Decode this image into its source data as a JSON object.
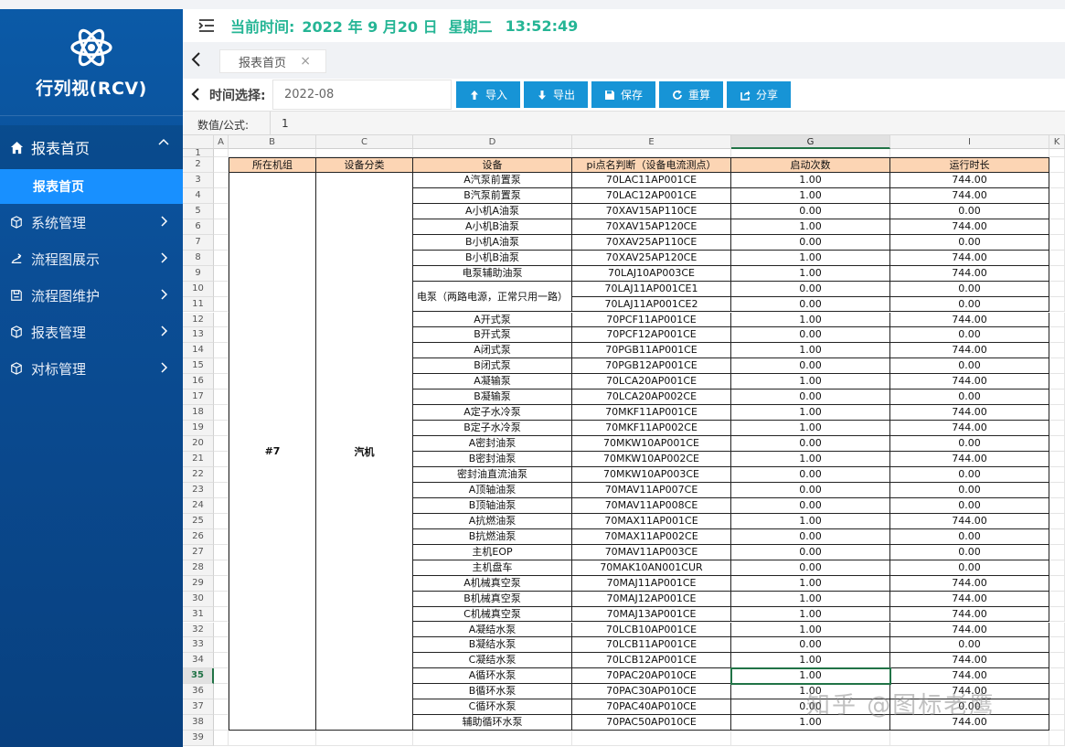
{
  "sidebar": {
    "title": "行列视(RCV)",
    "menu": [
      {
        "label": "报表首页",
        "icon": "home-icon",
        "open": true
      },
      {
        "label": "系统管理",
        "icon": "cube-icon"
      },
      {
        "label": "流程图展示",
        "icon": "flow-icon"
      },
      {
        "label": "流程图维护",
        "icon": "floppy-icon"
      },
      {
        "label": "报表管理",
        "icon": "cube-icon"
      },
      {
        "label": "对标管理",
        "icon": "cube-icon"
      }
    ],
    "submenu": {
      "label": "报表首页"
    }
  },
  "topbar": {
    "time_label": "当前时间:",
    "date": "2022 年 9 月20 日",
    "weekday": "星期二",
    "clock": "13:52:49"
  },
  "tabs": [
    {
      "label": "报表首页"
    }
  ],
  "toolbar": {
    "time_label": "时间选择:",
    "time_value": "2022-08",
    "buttons": [
      {
        "label": "导入",
        "icon": "arrow-up-icon"
      },
      {
        "label": "导出",
        "icon": "arrow-down-icon"
      },
      {
        "label": "保存",
        "icon": "save-icon"
      },
      {
        "label": "重算",
        "icon": "refresh-icon"
      },
      {
        "label": "分享",
        "icon": "share-icon"
      }
    ]
  },
  "formula": {
    "label": "数值/公式:",
    "value": "1"
  },
  "sheet": {
    "columns": [
      "A",
      "B",
      "C",
      "D",
      "E",
      "G",
      "I",
      "K"
    ],
    "selected_column": "G",
    "selected_row": 35,
    "row_numbers": [
      1,
      2,
      3,
      4,
      5,
      6,
      7,
      8,
      9,
      10,
      11,
      12,
      13,
      14,
      15,
      16,
      17,
      18,
      19,
      20,
      21,
      22,
      23,
      24,
      25,
      26,
      27,
      28,
      29,
      30,
      31,
      32,
      33,
      34,
      35,
      36,
      37,
      38,
      39
    ],
    "headers": [
      "所在机组",
      "设备分类",
      "设备",
      "pi点名判断（设备电流测点）",
      "启动次数",
      "运行时长"
    ],
    "group_unit": "#7",
    "group_category": "汽机",
    "merged_device": "电泵（两路电源，正常只用一路）",
    "rows": [
      {
        "device": "A汽泵前置泵",
        "pi": "70LAC11AP001CE",
        "starts": "1.00",
        "hours": "744.00"
      },
      {
        "device": "B汽泵前置泵",
        "pi": "70LAC12AP001CE",
        "starts": "1.00",
        "hours": "744.00"
      },
      {
        "device": "A小机A油泵",
        "pi": "70XAV15AP110CE",
        "starts": "0.00",
        "hours": "0.00"
      },
      {
        "device": "A小机B油泵",
        "pi": "70XAV15AP120CE",
        "starts": "1.00",
        "hours": "744.00"
      },
      {
        "device": "B小机A油泵",
        "pi": "70XAV25AP110CE",
        "starts": "0.00",
        "hours": "0.00"
      },
      {
        "device": "B小机B油泵",
        "pi": "70XAV25AP120CE",
        "starts": "1.00",
        "hours": "744.00"
      },
      {
        "device": "电泵辅助油泵",
        "pi": "70LAJ10AP003CE",
        "starts": "1.00",
        "hours": "744.00"
      },
      {
        "device": "",
        "pi": "70LAJ11AP001CE1",
        "starts": "0.00",
        "hours": "0.00"
      },
      {
        "device": "",
        "pi": "70LAJ11AP001CE2",
        "starts": "0.00",
        "hours": "0.00"
      },
      {
        "device": "A开式泵",
        "pi": "70PCF11AP001CE",
        "starts": "1.00",
        "hours": "744.00"
      },
      {
        "device": "B开式泵",
        "pi": "70PCF12AP001CE",
        "starts": "0.00",
        "hours": "0.00"
      },
      {
        "device": "A闭式泵",
        "pi": "70PGB11AP001CE",
        "starts": "1.00",
        "hours": "744.00"
      },
      {
        "device": "B闭式泵",
        "pi": "70PGB12AP001CE",
        "starts": "0.00",
        "hours": "0.00"
      },
      {
        "device": "A凝输泵",
        "pi": "70LCA20AP001CE",
        "starts": "1.00",
        "hours": "744.00"
      },
      {
        "device": "B凝输泵",
        "pi": "70LCA20AP002CE",
        "starts": "0.00",
        "hours": "0.00"
      },
      {
        "device": "A定子水冷泵",
        "pi": "70MKF11AP001CE",
        "starts": "1.00",
        "hours": "744.00"
      },
      {
        "device": "B定子水冷泵",
        "pi": "70MKF11AP002CE",
        "starts": "1.00",
        "hours": "744.00"
      },
      {
        "device": "A密封油泵",
        "pi": "70MKW10AP001CE",
        "starts": "0.00",
        "hours": "0.00"
      },
      {
        "device": "B密封油泵",
        "pi": "70MKW10AP002CE",
        "starts": "1.00",
        "hours": "744.00"
      },
      {
        "device": "密封油直流油泵",
        "pi": "70MKW10AP003CE",
        "starts": "0.00",
        "hours": "0.00"
      },
      {
        "device": "A顶轴油泵",
        "pi": "70MAV11AP007CE",
        "starts": "0.00",
        "hours": "0.00"
      },
      {
        "device": "B顶轴油泵",
        "pi": "70MAV11AP008CE",
        "starts": "0.00",
        "hours": "0.00"
      },
      {
        "device": "A抗燃油泵",
        "pi": "70MAX11AP001CE",
        "starts": "1.00",
        "hours": "744.00"
      },
      {
        "device": "B抗燃油泵",
        "pi": "70MAX11AP002CE",
        "starts": "0.00",
        "hours": "0.00"
      },
      {
        "device": "主机EOP",
        "pi": "70MAV11AP003CE",
        "starts": "0.00",
        "hours": "0.00"
      },
      {
        "device": "主机盘车",
        "pi": "70MAK10AN001CUR",
        "starts": "0.00",
        "hours": "0.00"
      },
      {
        "device": "A机械真空泵",
        "pi": "70MAJ11AP001CE",
        "starts": "1.00",
        "hours": "744.00"
      },
      {
        "device": "B机械真空泵",
        "pi": "70MAJ12AP001CE",
        "starts": "1.00",
        "hours": "744.00"
      },
      {
        "device": "C机械真空泵",
        "pi": "70MAJ13AP001CE",
        "starts": "1.00",
        "hours": "744.00"
      },
      {
        "device": "A凝结水泵",
        "pi": "70LCB10AP001CE",
        "starts": "1.00",
        "hours": "744.00"
      },
      {
        "device": "B凝结水泵",
        "pi": "70LCB11AP001CE",
        "starts": "0.00",
        "hours": "0.00"
      },
      {
        "device": "C凝结水泵",
        "pi": "70LCB12AP001CE",
        "starts": "1.00",
        "hours": "744.00"
      },
      {
        "device": "A循环水泵",
        "pi": "70PAC20AP010CE",
        "starts": "1.00",
        "hours": "744.00"
      },
      {
        "device": "B循环水泵",
        "pi": "70PAC30AP010CE",
        "starts": "1.00",
        "hours": "744.00"
      },
      {
        "device": "C循环水泵",
        "pi": "70PAC40AP010CE",
        "starts": "0.00",
        "hours": "0.00"
      },
      {
        "device": "辅助循环水泵",
        "pi": "70PAC50AP010CE",
        "starts": "1.00",
        "hours": "744.00"
      }
    ]
  },
  "watermark": "知乎 @图标老鹰",
  "colors": {
    "sidebar": "#0b5aa7",
    "submenu_active": "#1890ff",
    "accent_green": "#25b595",
    "button_blue": "#1794d6",
    "header_fill": "#fcd5b4",
    "selection_green": "#217346"
  }
}
